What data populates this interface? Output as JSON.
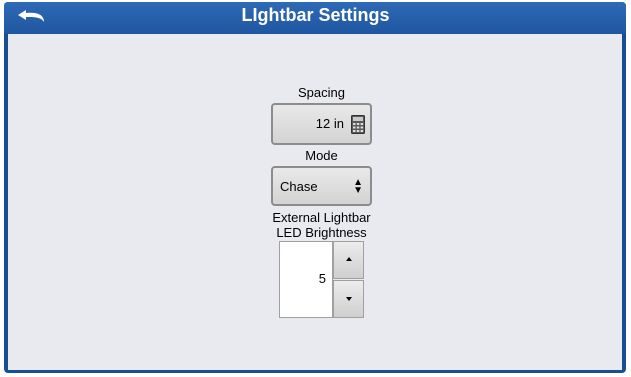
{
  "header": {
    "title": "LIghtbar Settings",
    "back_icon": "back-arrow-icon"
  },
  "spacing": {
    "label": "Spacing",
    "value": "12 in",
    "icon": "calculator-icon"
  },
  "mode": {
    "label": "Mode",
    "value": "Chase",
    "icon": "select-updown-icon"
  },
  "brightness": {
    "label_line1": "External Lightbar",
    "label_line2": "LED Brightness",
    "value": "5"
  },
  "colors": {
    "title_bar": "#1f56a0",
    "panel": "#e9eaf0"
  }
}
